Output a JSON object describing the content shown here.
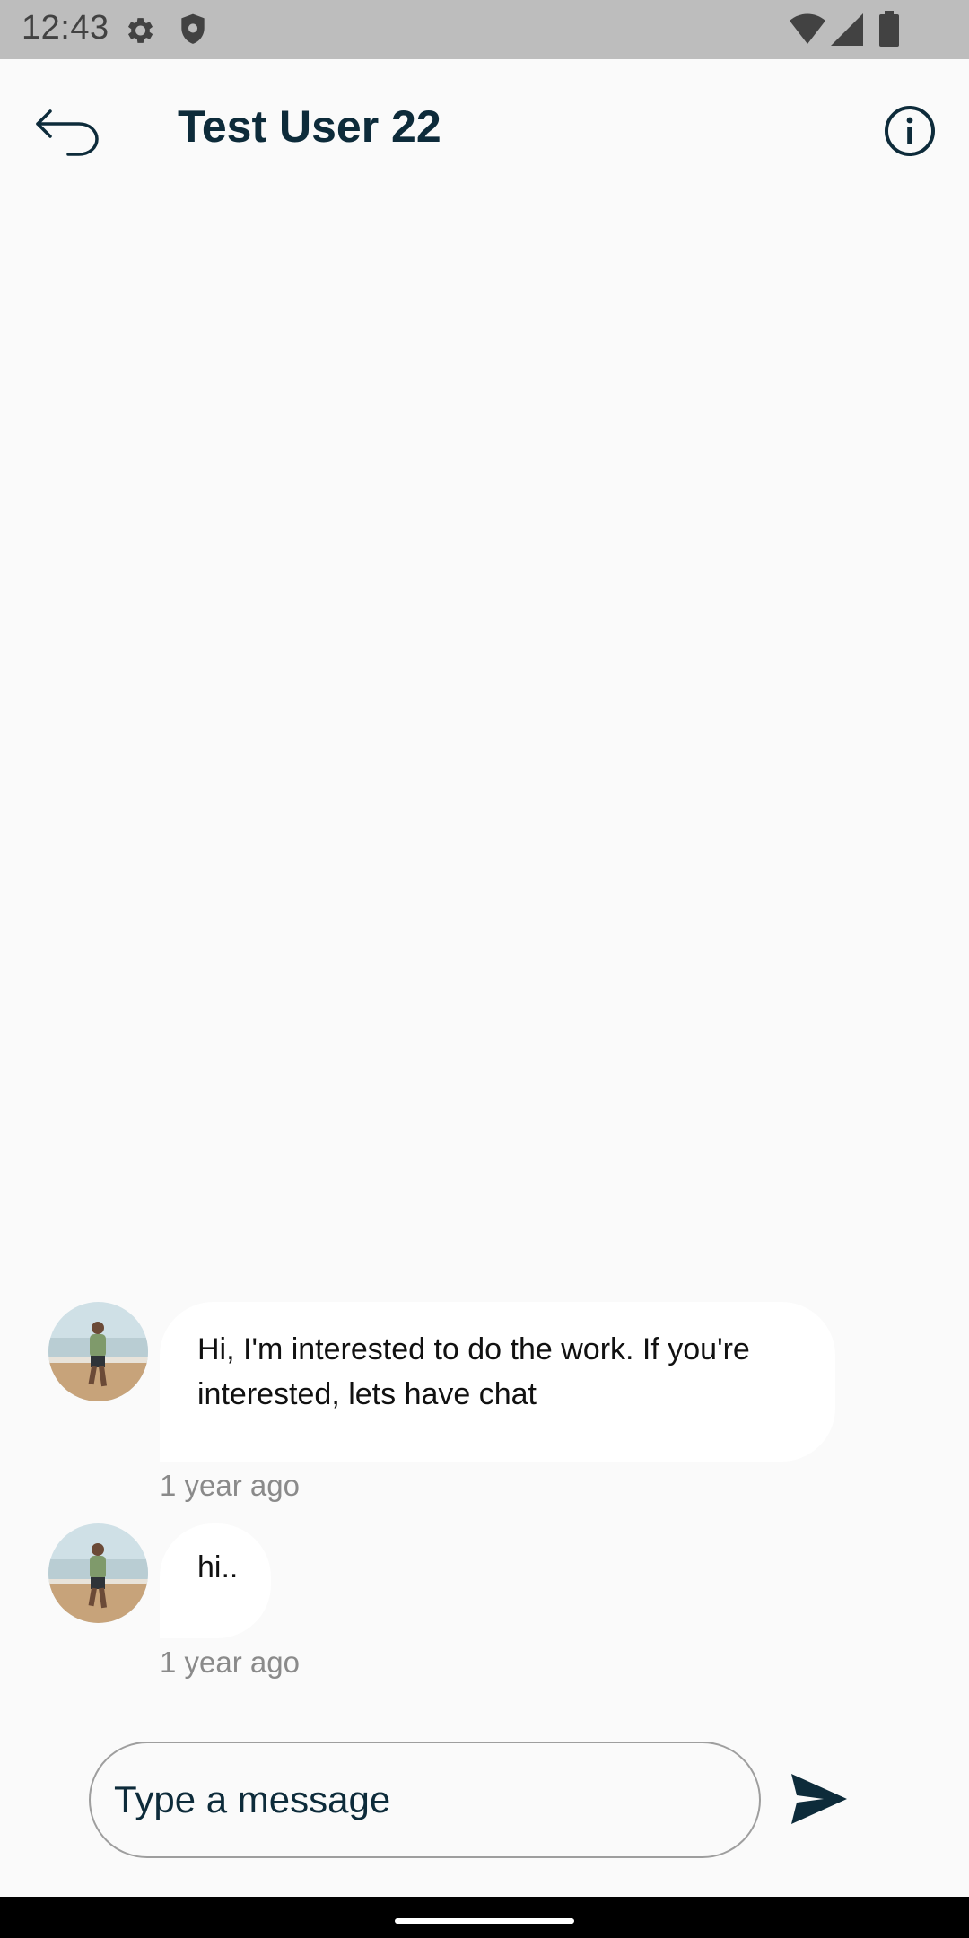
{
  "status_bar": {
    "time": "12:43",
    "icons": [
      "settings-icon",
      "shield-icon",
      "wifi-icon",
      "signal-icon",
      "battery-icon"
    ]
  },
  "header": {
    "title": "Test User 22",
    "back_icon": "back-arrow-icon",
    "info_icon": "info-icon"
  },
  "messages": [
    {
      "line1": "Hi, I'm interested to do the work. If you're",
      "line2": "interested, lets have chat",
      "time": "1 year ago"
    },
    {
      "line1": "hi..",
      "time": "1 year ago"
    }
  ],
  "composer": {
    "placeholder": "Type a message",
    "send_icon": "send-icon"
  },
  "colors": {
    "primary_text": "#0D2B3A",
    "background": "#FAFAFA",
    "bubble": "#FFFFFF",
    "status_bar": "#BDBDBD",
    "timestamp": "#8A8A8A"
  }
}
